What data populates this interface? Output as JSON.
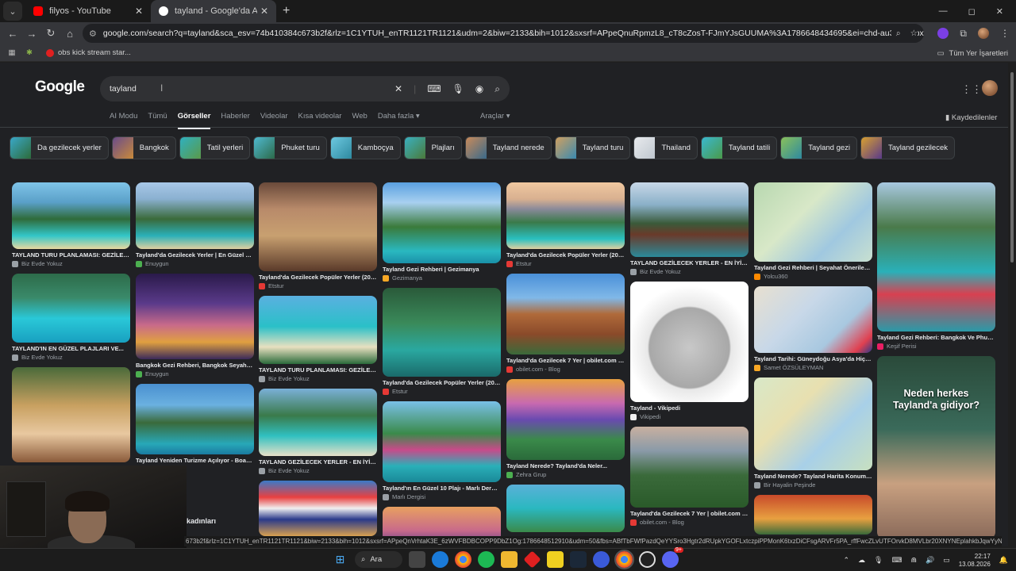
{
  "tabs": [
    {
      "title": "filyos - YouTube",
      "close": "✕"
    },
    {
      "title": "tayland - Google'da Ara",
      "close": "✕"
    }
  ],
  "new_tab": "+",
  "window_controls": {
    "minimize": "—",
    "maximize": "◻",
    "close": "✕"
  },
  "url": "google.com/search?q=tayland&sca_esv=74b410384c673b2f&rlz=1C1YTUH_enTR1121TR1121&udm=2&biw=2133&bih=1012&sxsrf=APpeQnuRpmzL8_cT8cZosT-FJmYJsGUUMA%3A1786648434695&ei=chd-au3-KbWpxc8PyKbfiAs&ved...",
  "bookmarks": {
    "item": "obs kick stream star...",
    "right": "Tüm Yer İşaretleri"
  },
  "google": {
    "logo": "Google",
    "query": "tayland",
    "nav": [
      "AI Modu",
      "Tümü",
      "Görseller",
      "Haberler",
      "Videolar",
      "Kısa videolar",
      "Web",
      "Daha fazla"
    ],
    "tools": "Araçlar",
    "saved": "Kaydedilenler"
  },
  "chips": [
    "Da gezilecek yerler",
    "Bangkok",
    "Tatil yerleri",
    "Phuket turu",
    "Kamboçya",
    "Plajları",
    "Tayland nerede",
    "Tayland turu",
    "Thailand",
    "Tayland tatili",
    "Tayland gezi",
    "Tayland gezilecek"
  ],
  "columns": [
    [
      {
        "cap": "TAYLAND TURU PLANLAMASI: GEZİLEC...",
        "src": "Biz Evde Yokuz"
      },
      {
        "cap": "TAYLAND'IN EN GÜZEL PLAJLARI VE...",
        "src": "Biz Evde Yokuz"
      },
      {
        "cap": "",
        "src": ""
      }
    ],
    [
      {
        "cap": "Tayland'da Gezilecek Yerler | En Güzel 47...",
        "src": "Enuygun"
      },
      {
        "cap": "Bangkok Gezi Rehberi, Bangkok Seyahat...",
        "src": "Enuygun"
      },
      {
        "cap": "Tayland Yeniden Turizme Açılıyor - Boardin...",
        "src": ""
      }
    ],
    [
      {
        "cap": "Tayland'da Gezilecek Popüler Yerler (2026...",
        "src": "Etstur"
      },
      {
        "cap": "TAYLAND TURU PLANLAMASI: GEZİLEC...",
        "src": "Biz Evde Yokuz"
      },
      {
        "cap": "TAYLAND GEZİLECEK YERLER - EN İYİ 1...",
        "src": "Biz Evde Yokuz"
      },
      {
        "cap": "",
        "src": ""
      }
    ],
    [
      {
        "cap": "Tayland Gezi Rehberi | Gezimanya",
        "src": "Gezimanya"
      },
      {
        "cap": "Tayland'da Gezilecek Popüler Yerler (2026...",
        "src": "Etstur"
      },
      {
        "cap": "Tayland'ın En Güzel 10 Plajı - Marlı Dergisi",
        "src": "Marlı Dergisi"
      },
      {
        "cap": "",
        "src": ""
      }
    ],
    [
      {
        "cap": "Tayland'da Gezilecek Popüler Yerler (2026...",
        "src": "Etstur"
      },
      {
        "cap": "Tayland'da Gezilecek 7 Yer | obilet.com -...",
        "src": "obilet.com - Blog"
      },
      {
        "cap": "Tayland Nerede? Tayland'da Neler...",
        "src": "Zehra Grup"
      },
      {
        "cap": "",
        "src": ""
      }
    ],
    [
      {
        "cap": "TAYLAND GEZİLECEK YERLER - EN İYİ 1...",
        "src": "Biz Evde Yokuz"
      },
      {
        "cap": "Tayland - Vikipedi",
        "src": "Vikipedi"
      },
      {
        "cap": "Tayland'da Gezilecek 7 Yer | obilet.com -...",
        "src": "obilet.com - Blog"
      }
    ],
    [
      {
        "cap": "Tayland Gezi Rehberi | Seyahat Önerileri |...",
        "src": "Yolcu360"
      },
      {
        "cap": "Tayland Tarihi: Güneydoğu Asya'da Hiç İşg...",
        "src": "Samet ÖZSÜLEYMAN"
      },
      {
        "cap": "Tayland Nerede? Tayland Harita Konumu...",
        "src": "Bir Hayalin Peşinde"
      },
      {
        "cap": "",
        "src": ""
      }
    ],
    [
      {
        "cap": "Tayland Gezi Rehberi: Bangkok Ve Phuket ...",
        "src": "Keşif Perisi"
      },
      {
        "cap": "",
        "src": ""
      }
    ]
  ],
  "video_overlay": "Neden herkes Tayland'a gidiyor?",
  "ghost_text": "kadınları",
  "status_url": "673b2f&rlz=1C1YTUH_enTR1121TR1121&biw=2133&bih=1012&sxsrf=APpeQnVrhtaK3E_6zWVFBDBCOPP9DbZ1Og:1786648512910&udm=50&fbs=ABfTbFWfPazdQeYYSro3Hgtr2dRUpkYGOFLxtczpiPPMonK6txzDiCFsgARVFr5PA_rffFwcZLvUTFOrvkD8MVLbr20XNYNEplahkbJqwYyNKQ8...",
  "taskbar": {
    "search": "Ara",
    "time": "22:17",
    "date": "13.08.2026",
    "badge": "9+"
  }
}
